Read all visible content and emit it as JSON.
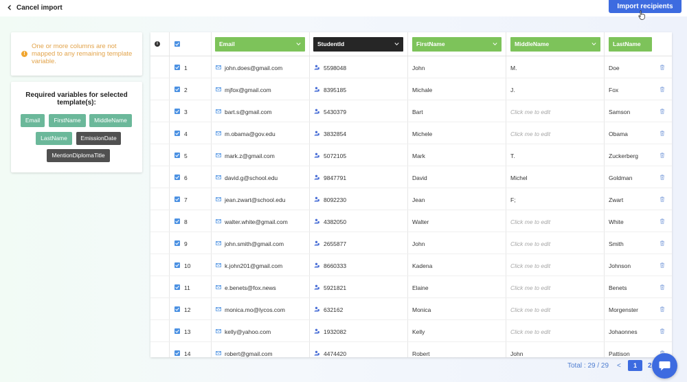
{
  "topbar": {
    "cancel_label": "Cancel import",
    "import_label": "Import recipients"
  },
  "warning": {
    "text": "One or more columns are not mapped to any remaining template variable."
  },
  "variables": {
    "title": "Required variables for selected template(s):",
    "tags": [
      {
        "label": "Email",
        "mapped": true
      },
      {
        "label": "FirstName",
        "mapped": true
      },
      {
        "label": "MiddleName",
        "mapped": true
      },
      {
        "label": "LastName",
        "mapped": true
      },
      {
        "label": "EmissionDate",
        "mapped": false
      },
      {
        "label": "MentionDiplomaTitle",
        "mapped": false
      }
    ]
  },
  "table": {
    "headers": [
      {
        "label": "Email",
        "state": "mapped"
      },
      {
        "label": "StudentId",
        "state": "unmapped"
      },
      {
        "label": "FirstName",
        "state": "mapped"
      },
      {
        "label": "MiddleName",
        "state": "mapped"
      },
      {
        "label": "LastName",
        "state": "mapped"
      }
    ],
    "edit_placeholder": "Click me to edit",
    "rows": [
      {
        "num": "1",
        "email": "john.does@gmail.com",
        "id": "5598048",
        "first": "John",
        "middle": "M.",
        "last": "Doe"
      },
      {
        "num": "2",
        "email": "mjfox@gmail.com",
        "id": "8395185",
        "first": "Michale",
        "middle": "J.",
        "last": "Fox"
      },
      {
        "num": "3",
        "email": "bart.s@gmail.com",
        "id": "5430379",
        "first": "Bart",
        "middle": "",
        "last": "Samson"
      },
      {
        "num": "4",
        "email": "m.obama@gov.edu",
        "id": "3832854",
        "first": "Michele",
        "middle": "",
        "last": "Obama"
      },
      {
        "num": "5",
        "email": "mark.z@gmail.com",
        "id": "5072105",
        "first": "Mark",
        "middle": "T.",
        "last": "Zuckerberg"
      },
      {
        "num": "6",
        "email": "david.g@school.edu",
        "id": "9847791",
        "first": "David",
        "middle": "Michel",
        "last": "Goldman"
      },
      {
        "num": "7",
        "email": "jean.zwart@school.edu",
        "id": "8092230",
        "first": "Jean",
        "middle": "F;",
        "last": "Zwart"
      },
      {
        "num": "8",
        "email": "walter.white@gmail.com",
        "id": "4382050",
        "first": "Walter",
        "middle": "",
        "last": "White"
      },
      {
        "num": "9",
        "email": "john.smith@gmail.com",
        "id": "2655877",
        "first": "John",
        "middle": "",
        "last": "Smith"
      },
      {
        "num": "10",
        "email": "k.john201@gmail.com",
        "id": "8660333",
        "first": "Kadena",
        "middle": "",
        "last": "Johnson"
      },
      {
        "num": "11",
        "email": "e.benets@fox.news",
        "id": "5921821",
        "first": "Elaine",
        "middle": "",
        "last": "Benets"
      },
      {
        "num": "12",
        "email": "monica.mo@lycos.com",
        "id": "632162",
        "first": "Monica",
        "middle": "",
        "last": "Morgenster"
      },
      {
        "num": "13",
        "email": "kelly@yahoo.com",
        "id": "1932082",
        "first": "Kelly",
        "middle": "",
        "last": "Johaonnes"
      },
      {
        "num": "14",
        "email": "robert@gmail.com",
        "id": "4474420",
        "first": "Robert",
        "middle": "John",
        "last": "Pattison"
      }
    ]
  },
  "pagination": {
    "total": "Total : 29 / 29",
    "prev": "<",
    "pages": [
      "1",
      "2"
    ]
  },
  "colors": {
    "accent": "#3d6be0",
    "mapped": "#7dc35a",
    "unmapped": "#262626",
    "tag_mapped": "#6bb89a",
    "tag_unmapped": "#505050",
    "warning": "#e2a34a"
  },
  "icons": {
    "back": "chevron-left-icon",
    "warning": "warning-icon",
    "info": "info-icon",
    "email": "envelope-icon",
    "student": "person-id-icon",
    "delete": "trash-icon",
    "dropdown": "chevron-down-icon",
    "chat": "chat-bubble-icon"
  }
}
